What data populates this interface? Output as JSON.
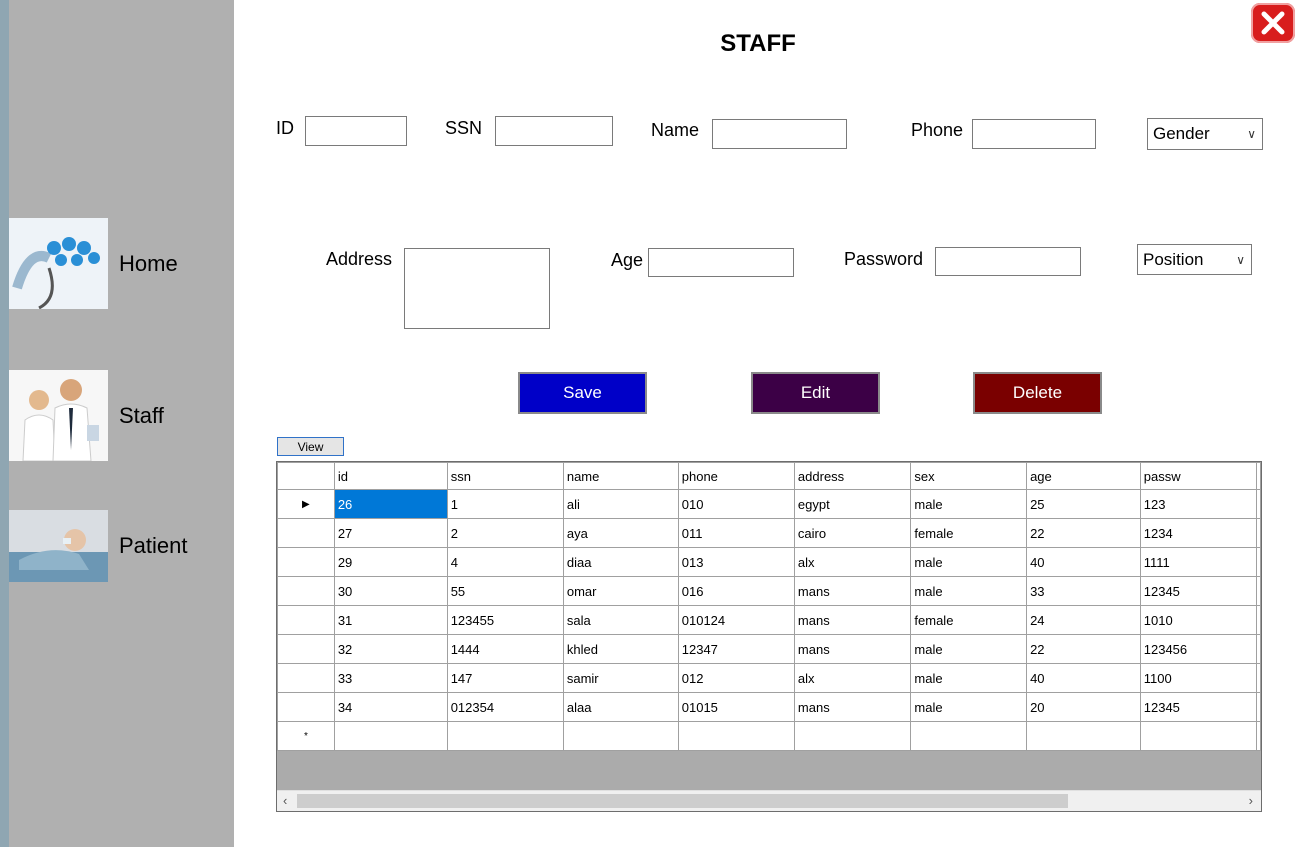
{
  "window": {
    "title": "STAFF"
  },
  "sidebar": {
    "items": [
      {
        "label": "Home"
      },
      {
        "label": "Staff"
      },
      {
        "label": "Patient"
      }
    ]
  },
  "form": {
    "id_label": "ID",
    "ssn_label": "SSN",
    "name_label": "Name",
    "phone_label": "Phone",
    "gender_value": "Gender",
    "address_label": "Address",
    "age_label": "Age",
    "password_label": "Password",
    "position_value": "Position"
  },
  "actions": {
    "save": "Save",
    "edit": "Edit",
    "delete": "Delete",
    "view": "View"
  },
  "colors": {
    "save": "#0000c8",
    "edit": "#3c0046",
    "delete": "#7a0000",
    "sidebar": "#b0b0b0",
    "selection": "#0078d7"
  },
  "table": {
    "columns": [
      "id",
      "ssn",
      "name",
      "phone",
      "address",
      "sex",
      "age",
      "passw"
    ],
    "rows": [
      [
        "26",
        "1",
        "ali",
        "010",
        "egypt",
        "male",
        "25",
        "123"
      ],
      [
        "27",
        "2",
        "aya",
        "011",
        "cairo",
        "female",
        "22",
        "1234"
      ],
      [
        "29",
        "4",
        "diaa",
        "013",
        "alx",
        "male",
        "40",
        "1111"
      ],
      [
        "30",
        "55",
        "omar",
        "016",
        "mans",
        "male",
        "33",
        "12345"
      ],
      [
        "31",
        "123455",
        "sala",
        "010124",
        "mans",
        "female",
        "24",
        "1010"
      ],
      [
        "32",
        "1444",
        "khled",
        "12347",
        "mans",
        "male",
        "22",
        "123456"
      ],
      [
        "33",
        "147",
        "samir",
        "012",
        "alx",
        "male",
        "40",
        "1100"
      ],
      [
        "34",
        "012354",
        "alaa",
        "01015",
        "mans",
        "male",
        "20",
        "12345"
      ]
    ],
    "current_row_marker": "▶",
    "new_row_marker": "*"
  }
}
